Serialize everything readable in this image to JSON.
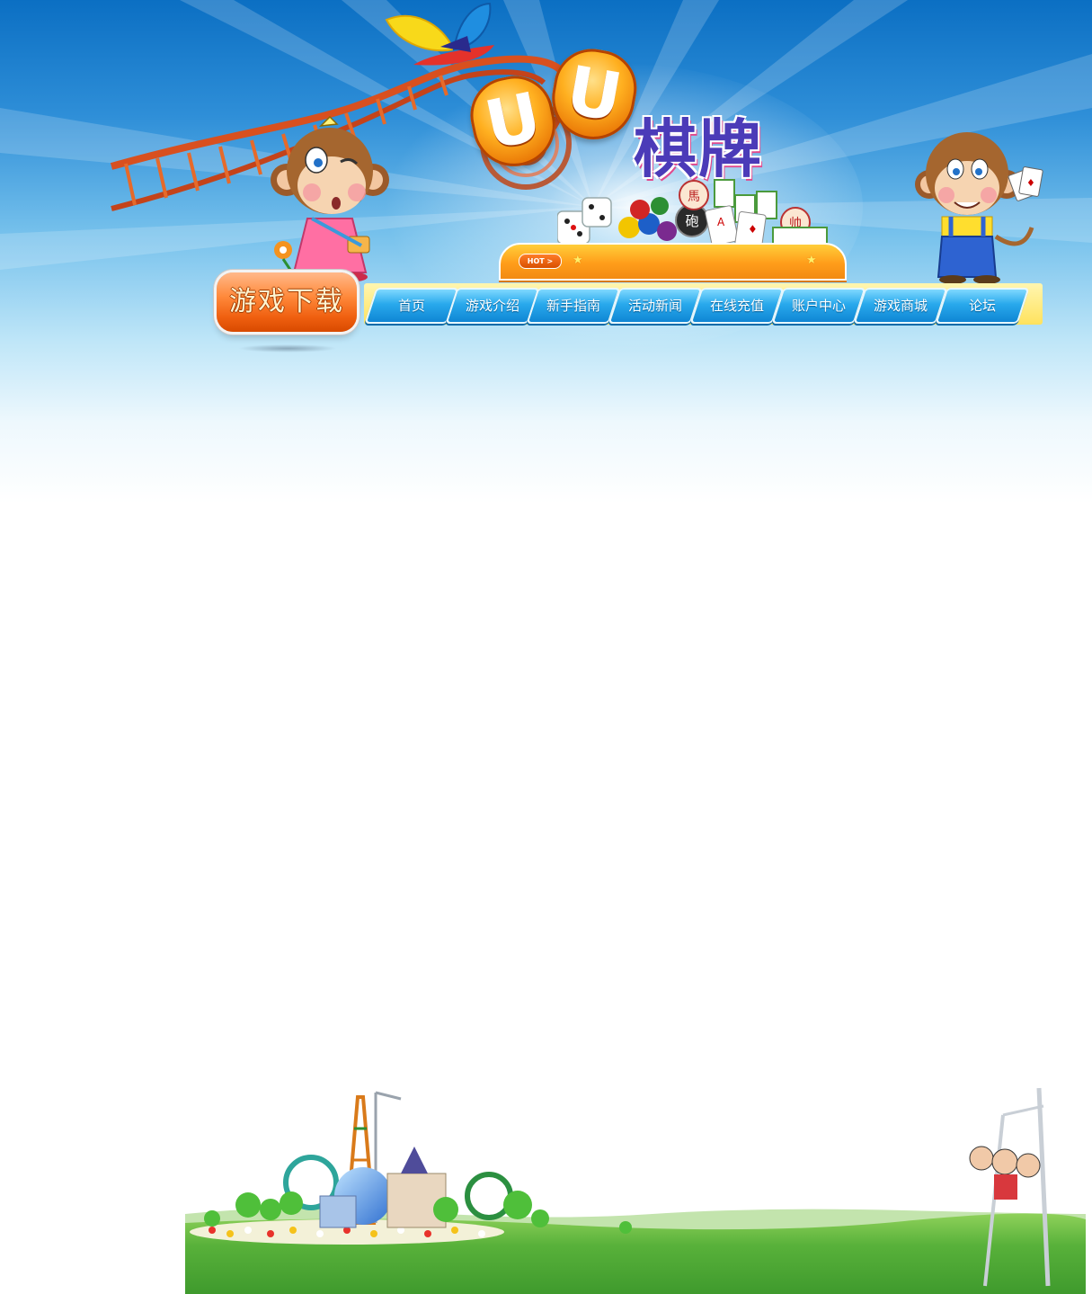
{
  "header": {
    "logo": {
      "letters": "UU",
      "title": "棋牌"
    },
    "hot_badge": "HOT >",
    "download_button": "游戏下载"
  },
  "nav": {
    "items": [
      {
        "label": "首页"
      },
      {
        "label": "游戏介绍"
      },
      {
        "label": "新手指南"
      },
      {
        "label": "活动新闻"
      },
      {
        "label": "在线充值"
      },
      {
        "label": "账户中心"
      },
      {
        "label": "游戏商城"
      },
      {
        "label": "论坛"
      }
    ]
  },
  "colors": {
    "sky_top": "#0b6fc3",
    "nav_blue": "#29a9ec",
    "brand_orange": "#ff9d1a",
    "logo_purple": "#4b3bb8",
    "grass": "#4bb43a"
  }
}
